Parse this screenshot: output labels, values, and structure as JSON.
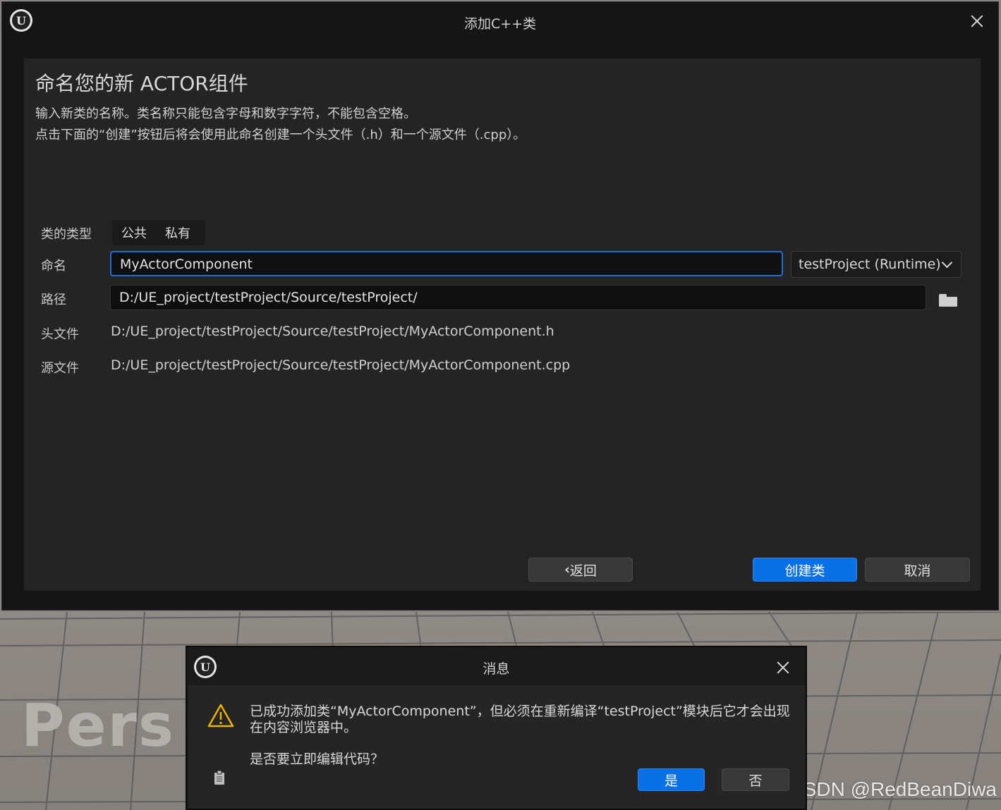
{
  "main_window": {
    "title": "添加C++类",
    "heading": "命名您的新 ACTOR组件",
    "description_line1": "输入新类的名称。类名称只能包含字母和数字字符，不能包含空格。",
    "description_line2": "点击下面的“创建”按钮后将会使用此命名创建一个头文件（.h）和一个源文件（.cpp）。",
    "class_type_label": "类的类型",
    "class_type_options": [
      "公共",
      "私有"
    ],
    "name_label": "命名",
    "name_value": "MyActorComponent",
    "module_dropdown": "testProject (Runtime)",
    "path_label": "路径",
    "path_value": "D:/UE_project/testProject/Source/testProject/",
    "header_label": "头文件",
    "header_path": "D:/UE_project/testProject/Source/testProject/MyActorComponent.h",
    "source_label": "源文件",
    "source_path": "D:/UE_project/testProject/Source/testProject/MyActorComponent.cpp",
    "back_button": "返回",
    "create_button": "创建类",
    "cancel_button": "取消"
  },
  "message_dialog": {
    "title": "消息",
    "text_line1": "已成功添加类“MyActorComponent”，但必须在重新编译“testProject”模块后它才会出现",
    "text_line2": "在内容浏览器中。",
    "question": "是否要立即编辑代码？",
    "yes_button": "是",
    "no_button": "否"
  },
  "viewport": {
    "overlay_text": "Pers"
  },
  "watermark": "CSDN @RedBeanDiwa",
  "colors": {
    "accent_blue": "#0a70e6",
    "focus_border": "#1f6fd2",
    "warning_yellow": "#e8b400",
    "panel_bg": "#242424"
  },
  "icons": {
    "logo": "unreal-logo-icon",
    "close": "close-icon",
    "dropdown": "chevron-down-icon",
    "browse": "folder-icon",
    "back": "chevron-left-icon",
    "warning": "warning-icon",
    "copy": "clipboard-icon"
  }
}
